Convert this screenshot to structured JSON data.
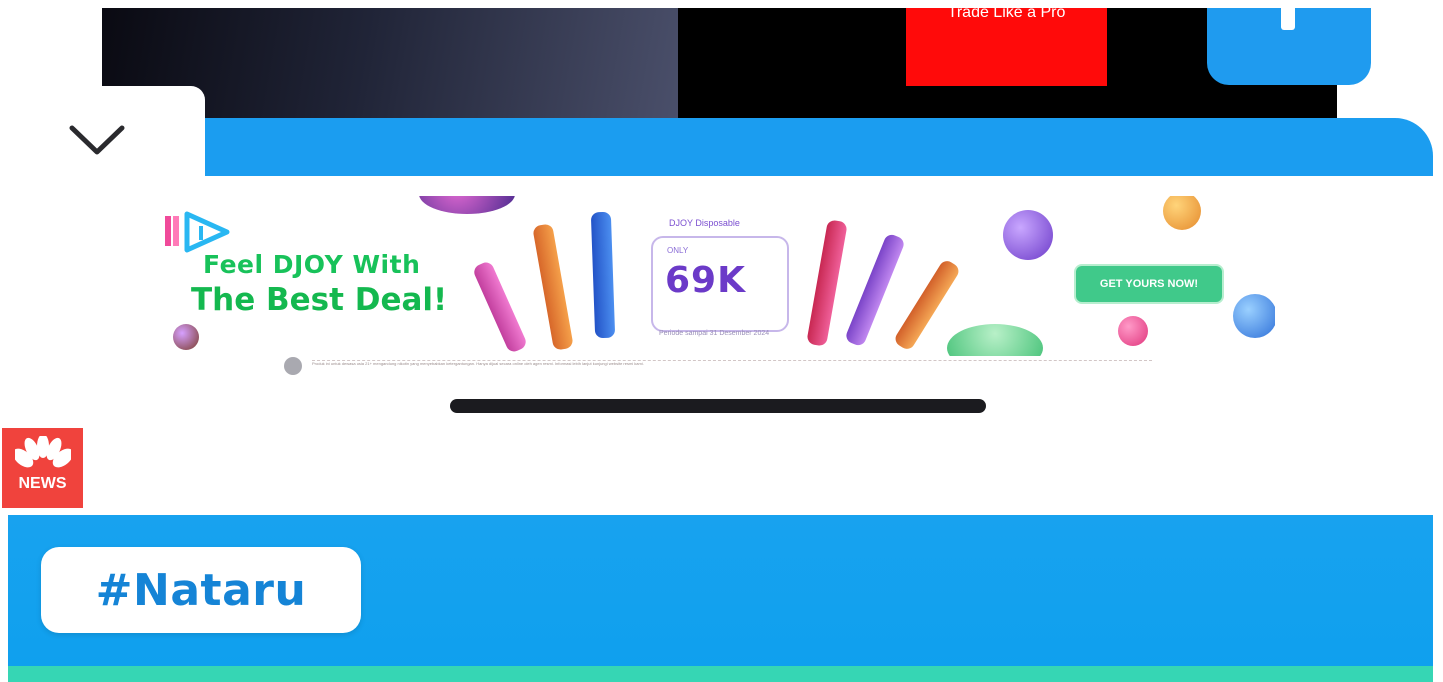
{
  "top_strip": {
    "promo_text": "Trade Like a Pro"
  },
  "ad": {
    "headline_line1": "Feel DJOY With",
    "headline_line2": "The Best Deal!",
    "price_top_label": "DJOY Disposable",
    "price_small_label": "ONLY",
    "price_value": "69K",
    "price_footer": "Periode sampai 31 Desember 2024",
    "cta_label": "GET YOURS NOW!",
    "disclaimer": "Produk ini untuk dewasa usia 21+ mengandung nikotin yang menyebabkan ketergantungan. Hanya dijual secara online oleh agen resmi. Informasi lebih lanjut kunjungi website resmi kami."
  },
  "news_logo": {
    "label": "NEWS"
  },
  "hashtag": {
    "label": "#Nataru"
  },
  "colors": {
    "accent_blue": "#1b9df0",
    "teal": "#36d6b4",
    "news_red": "#f0433d",
    "ad_green": "#18c25a",
    "price_purple": "#6b3ac8"
  },
  "icons": [
    "chevron-down-icon",
    "djoy-logo-icon",
    "news-peacock-icon",
    "plus-icon",
    "info-icon"
  ]
}
